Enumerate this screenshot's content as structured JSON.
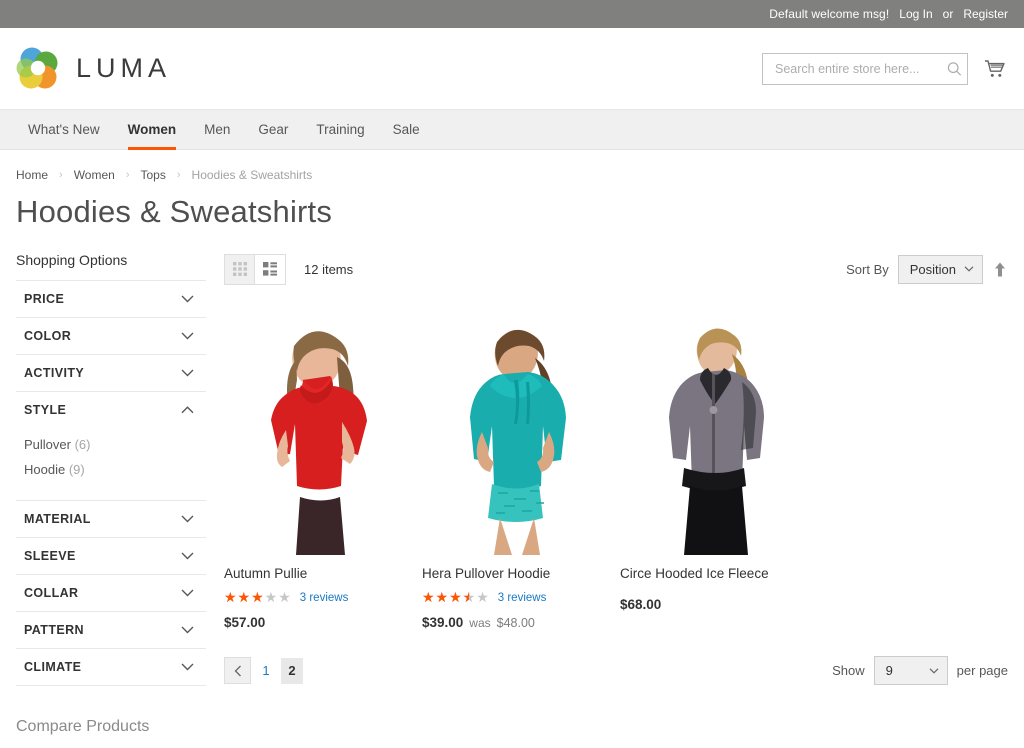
{
  "top_panel": {
    "welcome": "Default welcome msg!",
    "login_label": "Log In",
    "separator": "or",
    "register_label": "Register"
  },
  "header": {
    "logo_text": "LUMA",
    "logo_icon": "luma-flower-logo",
    "search": {
      "placeholder": "Search entire store here...",
      "value": "",
      "icon": "search-icon"
    },
    "cart_icon": "shopping-cart-icon"
  },
  "nav": {
    "items": [
      {
        "label": "What's New",
        "active": false
      },
      {
        "label": "Women",
        "active": true
      },
      {
        "label": "Men",
        "active": false
      },
      {
        "label": "Gear",
        "active": false
      },
      {
        "label": "Training",
        "active": false
      },
      {
        "label": "Sale",
        "active": false
      }
    ]
  },
  "breadcrumbs": [
    {
      "label": "Home",
      "current": false
    },
    {
      "label": "Women",
      "current": false
    },
    {
      "label": "Tops",
      "current": false
    },
    {
      "label": "Hoodies & Sweatshirts",
      "current": true
    }
  ],
  "breadcrumb_separator": "›",
  "page_title": "Hoodies & Sweatshirts",
  "sidebar": {
    "title": "Shopping Options",
    "filters": [
      {
        "label": "PRICE",
        "expanded": false,
        "items": []
      },
      {
        "label": "COLOR",
        "expanded": false,
        "items": []
      },
      {
        "label": "ACTIVITY",
        "expanded": false,
        "items": []
      },
      {
        "label": "STYLE",
        "expanded": true,
        "items": [
          {
            "name": "Pullover",
            "count": "(6)"
          },
          {
            "name": "Hoodie",
            "count": "(9)"
          }
        ]
      },
      {
        "label": "MATERIAL",
        "expanded": false,
        "items": []
      },
      {
        "label": "SLEEVE",
        "expanded": false,
        "items": []
      },
      {
        "label": "COLLAR",
        "expanded": false,
        "items": []
      },
      {
        "label": "PATTERN",
        "expanded": false,
        "items": []
      },
      {
        "label": "CLIMATE",
        "expanded": false,
        "items": []
      }
    ],
    "compare_title": "Compare Products"
  },
  "toolbar": {
    "modes": [
      {
        "name": "grid-view",
        "icon": "grid-icon",
        "active": false
      },
      {
        "name": "list-view",
        "icon": "list-icon",
        "active": true
      }
    ],
    "amount": "12 items",
    "sorter_label": "Sort By",
    "sorter_value": "Position",
    "sort_direction_icon": "arrow-up-icon"
  },
  "products": [
    {
      "name": "Autumn Pullie",
      "image": "red-cowl-neck-top-on-model",
      "rating_percent": 60,
      "rating_stars": "★★★★★",
      "reviews": "3 reviews",
      "price": "$57.00",
      "old_price": null,
      "was_label": null
    },
    {
      "name": "Hera Pullover Hoodie",
      "image": "teal-pullover-hoodie-on-model",
      "rating_percent": 70,
      "rating_stars": "★★★★★",
      "reviews": "3 reviews",
      "price": "$39.00",
      "old_price": "$48.00",
      "was_label": "was"
    },
    {
      "name": "Circe Hooded Ice Fleece",
      "image": "grey-zip-hoodie-on-model",
      "rating_percent": 0,
      "rating_stars": "",
      "reviews": null,
      "price": "$68.00",
      "old_price": null,
      "was_label": null
    }
  ],
  "bottom_toolbar": {
    "prev_icon": "chevron-left-icon",
    "pages": [
      {
        "label": "1",
        "current": false
      },
      {
        "label": "2",
        "current": true
      }
    ],
    "show_label": "Show",
    "limit_value": "9",
    "per_page_label": "per page"
  },
  "colors": {
    "accent_orange": "#ff5501",
    "link_blue": "#1979c3",
    "panel_grey": "#80807e",
    "nav_bg": "#f0f0f0"
  }
}
